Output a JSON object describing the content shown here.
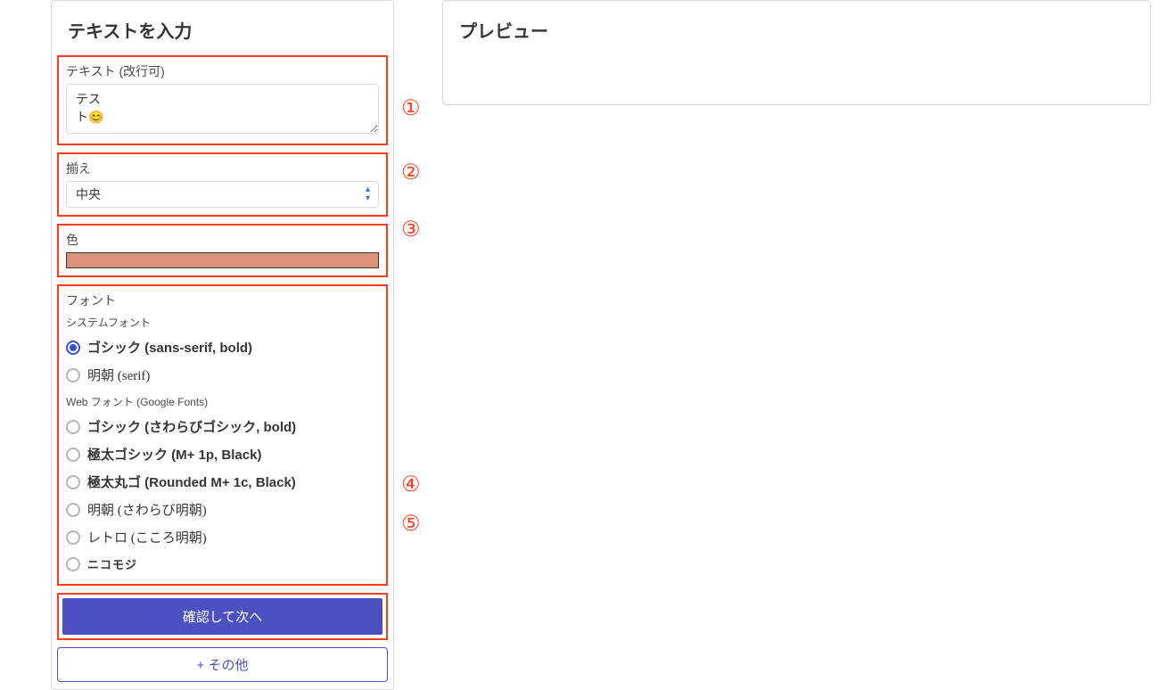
{
  "form": {
    "title": "テキストを入力",
    "sections": {
      "text": {
        "label": "テキスト (改行可)",
        "value": "テス\nト😊"
      },
      "align": {
        "label": "揃え",
        "selected": "中央"
      },
      "color": {
        "label": "色",
        "value": "#dd9277"
      },
      "font": {
        "label": "フォント",
        "group1_label": "システムフォント",
        "group2_label": "Web フォント (Google Fonts)",
        "options": [
          {
            "label": "ゴシック (sans-serif, bold)",
            "selected": true,
            "styleClass": "bold"
          },
          {
            "label": "明朝 (serif)",
            "selected": false,
            "styleClass": "serif"
          },
          {
            "label": "ゴシック (さわらびゴシック, bold)",
            "selected": false,
            "styleClass": "bold"
          },
          {
            "label": "極太ゴシック (M+ 1p, Black)",
            "selected": false,
            "styleClass": "black serif"
          },
          {
            "label": "極太丸ゴ (Rounded M+ 1c, Black)",
            "selected": false,
            "styleClass": "rounded-black"
          },
          {
            "label": "明朝 (さわらび明朝)",
            "selected": false,
            "styleClass": "serif"
          },
          {
            "label": "レトロ (こころ明朝)",
            "selected": false,
            "styleClass": "retro"
          },
          {
            "label": "ニコモジ",
            "selected": false,
            "styleClass": "nico"
          }
        ]
      }
    },
    "buttons": {
      "confirm": "確認して次へ",
      "other": "+ その他"
    }
  },
  "preview": {
    "title": "プレビュー"
  },
  "annotations": [
    "①",
    "②",
    "③",
    "④",
    "⑤"
  ],
  "annotation_offsets": [
    48,
    48,
    40,
    262,
    20
  ]
}
